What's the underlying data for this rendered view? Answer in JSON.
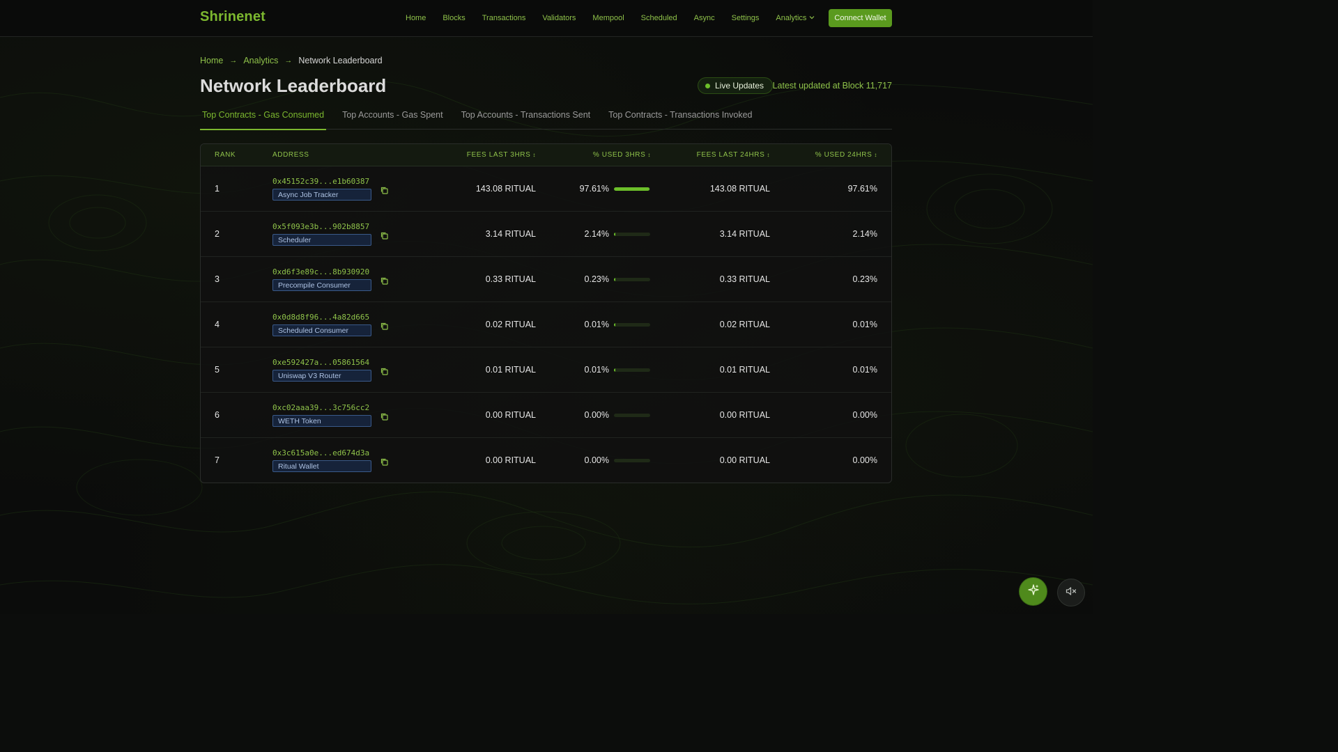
{
  "app": {
    "brand": "Shrinenet",
    "connect_label": "Connect Wallet"
  },
  "nav": {
    "items": [
      {
        "label": "Home"
      },
      {
        "label": "Blocks"
      },
      {
        "label": "Transactions"
      },
      {
        "label": "Validators"
      },
      {
        "label": "Mempool"
      },
      {
        "label": "Scheduled"
      },
      {
        "label": "Async"
      },
      {
        "label": "Settings"
      },
      {
        "label": "Analytics",
        "icon": "chevron-down-icon"
      }
    ]
  },
  "breadcrumb": {
    "items": [
      "Home",
      "Analytics"
    ],
    "separator": "→",
    "current": "Network Leaderboard"
  },
  "page": {
    "title": "Network Leaderboard",
    "live_label": "Live Updates",
    "latest_text": "Latest updated at Block 11,717"
  },
  "tabs": [
    {
      "label": "Top Contracts - Gas Consumed",
      "active": true
    },
    {
      "label": "Top Accounts - Gas Spent",
      "active": false
    },
    {
      "label": "Top Accounts - Transactions Sent",
      "active": false
    },
    {
      "label": "Top Contracts - Transactions Invoked",
      "active": false
    }
  ],
  "table": {
    "headers": {
      "rank": "RANK",
      "address": "ADDRESS",
      "fees3": "FEES LAST 3HRS",
      "pct3": "% USED 3HRS",
      "fees24": "FEES LAST 24HRS",
      "pct24": "% USED 24HRS",
      "sort_glyph": "↕"
    },
    "rows": [
      {
        "rank": "1",
        "address": "0x45152c39...e1b60387",
        "label": "Async Job Tracker",
        "fees3": "143.08 RITUAL",
        "pct3": "97.61%",
        "usage": 0.9761,
        "fees24": "143.08 RITUAL",
        "pct24": "97.61%"
      },
      {
        "rank": "2",
        "address": "0x5f093e3b...902b8857",
        "label": "Scheduler",
        "fees3": "3.14 RITUAL",
        "pct3": "2.14%",
        "usage": 0.0214,
        "fees24": "3.14 RITUAL",
        "pct24": "2.14%"
      },
      {
        "rank": "3",
        "address": "0xd6f3e89c...8b930920",
        "label": "Precompile Consumer",
        "fees3": "0.33 RITUAL",
        "pct3": "0.23%",
        "usage": 0.0023,
        "fees24": "0.33 RITUAL",
        "pct24": "0.23%"
      },
      {
        "rank": "4",
        "address": "0x0d8d8f96...4a82d665",
        "label": "Scheduled Consumer",
        "fees3": "0.02 RITUAL",
        "pct3": "0.01%",
        "usage": 0.0001,
        "fees24": "0.02 RITUAL",
        "pct24": "0.01%"
      },
      {
        "rank": "5",
        "address": "0xe592427a...05861564",
        "label": "Uniswap V3 Router",
        "fees3": "0.01 RITUAL",
        "pct3": "0.01%",
        "usage": 0.0001,
        "fees24": "0.01 RITUAL",
        "pct24": "0.01%"
      },
      {
        "rank": "6",
        "address": "0xc02aaa39...3c756cc2",
        "label": "WETH Token",
        "fees3": "0.00 RITUAL",
        "pct3": "0.00%",
        "usage": 0,
        "fees24": "0.00 RITUAL",
        "pct24": "0.00%"
      },
      {
        "rank": "7",
        "address": "0x3c615a0e...ed674d3a",
        "label": "Ritual Wallet",
        "fees3": "0.00 RITUAL",
        "pct3": "0.00%",
        "usage": 0,
        "fees24": "0.00 RITUAL",
        "pct24": "0.00%"
      }
    ]
  },
  "fabs": {
    "ai_icon": "sparkle-icon",
    "mute_icon": "speaker-muted-icon"
  },
  "colors": {
    "accent": "#7cb82f",
    "accent_bright": "#6cbf2a",
    "button_bg": "#5a9a1e",
    "chip_border": "#3a5a8a",
    "chip_text": "#aec3e4",
    "background": "#0b0c0b"
  }
}
